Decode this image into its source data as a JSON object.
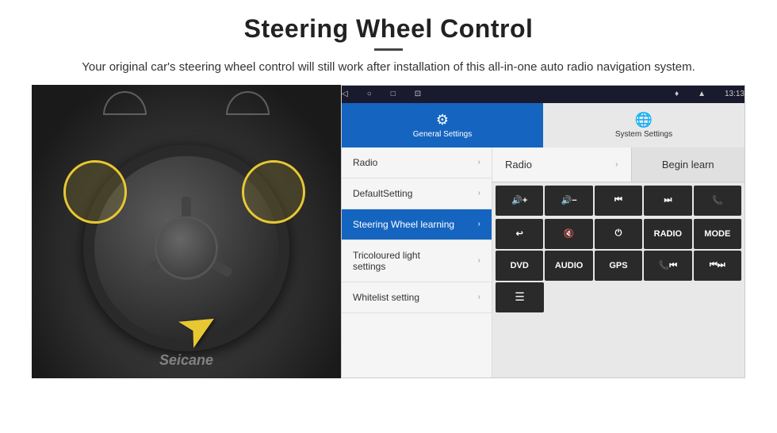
{
  "header": {
    "title": "Steering Wheel Control",
    "subtitle": "Your original car's steering wheel control will still work after installation of this all-in-one auto radio navigation system."
  },
  "status_bar": {
    "time": "13:13",
    "nav_icons": [
      "◁",
      "○",
      "□",
      "⊡"
    ]
  },
  "tabs": [
    {
      "label": "General Settings",
      "icon": "⚙",
      "active": true
    },
    {
      "label": "System Settings",
      "icon": "🌐",
      "active": false
    }
  ],
  "menu": [
    {
      "label": "Radio",
      "active": false
    },
    {
      "label": "DefaultSetting",
      "active": false
    },
    {
      "label": "Steering Wheel learning",
      "active": true
    },
    {
      "label": "Tricoloured light settings",
      "active": false
    },
    {
      "label": "Whitelist setting",
      "active": false
    }
  ],
  "radio_row": {
    "label": "Radio",
    "begin_learn": "Begin learn"
  },
  "control_buttons": {
    "row1": [
      "🔊+",
      "🔊−",
      "⏮",
      "⏭",
      "📞"
    ],
    "row1_labels": [
      "VOL+",
      "VOL-",
      "PREV",
      "NEXT",
      "CALL"
    ],
    "row2": [
      "↩",
      "🔇",
      "⏻",
      "RADIO",
      "MODE"
    ],
    "row3": [
      "DVD",
      "AUDIO",
      "GPS",
      "📞⏮",
      "⏮⏭"
    ],
    "row4_label": "≡"
  },
  "watermark": "Seicane"
}
